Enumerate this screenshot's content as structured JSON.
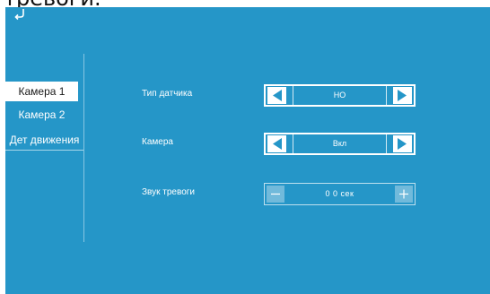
{
  "header": {
    "partial_title": "тревоги."
  },
  "icons": {
    "back": "back-arrow-icon"
  },
  "sidebar": {
    "items": [
      {
        "label": "Камера 1",
        "active": true
      },
      {
        "label": "Камера 2",
        "active": false
      },
      {
        "label": "Дет движения",
        "active": false
      }
    ]
  },
  "settings": {
    "sensor_type": {
      "label": "Тип датчика",
      "value": "НО"
    },
    "camera": {
      "label": "Камера",
      "value": "Вкл"
    },
    "alarm_sound": {
      "label": "Звук тревоги",
      "value": "0 0 сек"
    }
  },
  "colors": {
    "background": "#2596c8",
    "foreground": "#ffffff"
  }
}
